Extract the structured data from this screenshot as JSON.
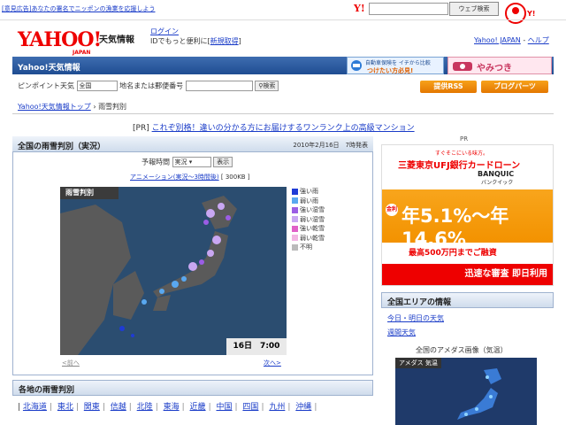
{
  "topbar": {
    "notice": "[意見広告]あなたの署名でニッポンの漁業を応援しよう",
    "yahoo_small": "Y!",
    "search_button": "ウェブ検索"
  },
  "header": {
    "logo": "YAHOO!",
    "logo_sub": "JAPAN",
    "service": "天気情報",
    "login": "ログイン",
    "login_sub_prefix": "IDでもっと便利に[",
    "register": "新規取得",
    "login_sub_suffix": "]",
    "top_link": "Yahoo! JAPAN",
    "sep": "-",
    "help_link": "ヘルプ"
  },
  "bluebar": {
    "title": "Yahoo!天気情報",
    "ad1_line1": "自動車保険を イチから比較",
    "ad1_line2": "つけたい方必見!",
    "ad2_text": "やみつき"
  },
  "search": {
    "label": "ピンポイント天気",
    "select_value": "全国",
    "input_label": "地名または郵便番号",
    "button": "検索"
  },
  "buttons": {
    "rss": "提供RSS",
    "blogparts": "ブログパーツ"
  },
  "breadcrumb": {
    "parent": "Yahoo!天気情報トップ",
    "current": "雨雪判別"
  },
  "pr": {
    "prefix": "[PR]",
    "link": "これぞ別格！違いの分かる方にお届けするワンランク上の高級マンション"
  },
  "panel": {
    "title": "全国の雨雪判別（実況）",
    "date": "2010年2月16日　7時発表",
    "forecast_label": "予報時間",
    "forecast_value": "実況",
    "show_button": "表示",
    "anim_link": "アニメーション(実況〜3時間後)",
    "anim_size": "[ 300KB ]",
    "map_label": "雨雪判別",
    "timestamp": "16日　7:00",
    "prev": "<前へ",
    "next": "次へ>"
  },
  "legend": [
    {
      "label": "強い雨",
      "color": "#1f3bd6"
    },
    {
      "label": "弱い雨",
      "color": "#59a8f0"
    },
    {
      "label": "強い湿雪",
      "color": "#9b5de5"
    },
    {
      "label": "弱い湿雪",
      "color": "#c9a7f2"
    },
    {
      "label": "強い乾雪",
      "color": "#e060c8"
    },
    {
      "label": "弱い乾雪",
      "color": "#f2b5e3"
    },
    {
      "label": "不明",
      "color": "#bbbbbb"
    }
  ],
  "regions_section": {
    "title": "各地の雨雪判別",
    "regions": [
      "北海道",
      "東北",
      "関東",
      "信越",
      "北陸",
      "東海",
      "近畿",
      "中国",
      "四国",
      "九州",
      "沖縄"
    ]
  },
  "right": {
    "pr_label": "PR",
    "ad_tag": "すぐそこにいる味方。",
    "ad_bank": "三菱東京UFJ銀行カードローン",
    "ad_brand": "BANQUIC",
    "ad_brand_sub": "バンクイック",
    "ad_rate_label": "金利",
    "ad_rate": "年5.1%〜年14.6%",
    "ad_limit": "最高500万円までご融資",
    "ad_footer": "迅速な審査 即日利用",
    "area_title": "全国エリアの情報",
    "links": [
      "今日・明日の天気",
      "週間天気"
    ],
    "amedas_title": "全国のアメダス画像（気温）",
    "amedas_label": "アメダス 気温"
  },
  "colors": {
    "accent": "#1f4d92",
    "logo_red": "#ee0000",
    "orange": "#f39200"
  }
}
